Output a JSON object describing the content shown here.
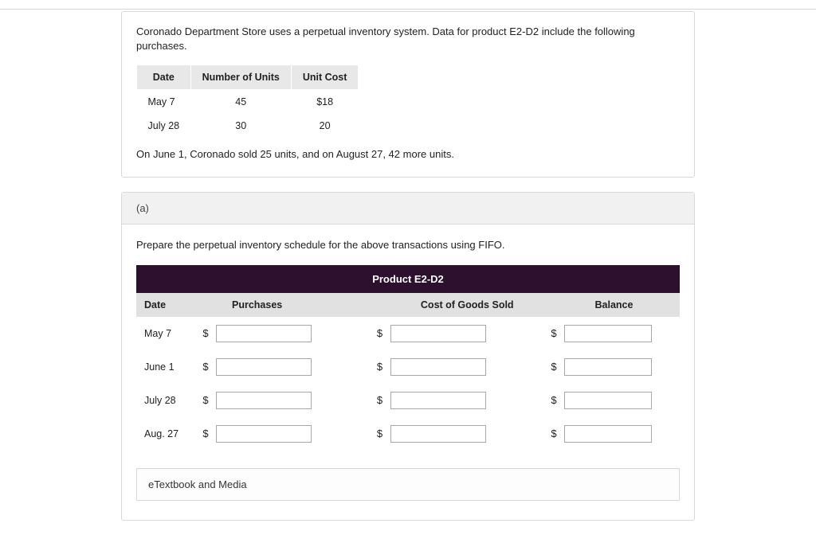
{
  "intro": "Coronado Department Store uses a perpetual inventory system. Data for product E2-D2 include the following purchases.",
  "purchase_table": {
    "headers": [
      "Date",
      "Number of Units",
      "Unit Cost"
    ],
    "rows": [
      {
        "date": "May 7",
        "units": "45",
        "cost": "$18"
      },
      {
        "date": "July 28",
        "units": "30",
        "cost": "20"
      }
    ]
  },
  "after_table": "On June 1, Coronado sold 25 units, and on August 27, 42 more units.",
  "part_label": "(a)",
  "instruction": "Prepare the perpetual inventory schedule for the above transactions using FIFO.",
  "schedule": {
    "title": "Product E2-D2",
    "columns": {
      "date": "Date",
      "purchases": "Purchases",
      "cogs": "Cost of Goods Sold",
      "balance": "Balance"
    },
    "rows": [
      {
        "date": "May 7"
      },
      {
        "date": "June 1"
      },
      {
        "date": "July 28"
      },
      {
        "date": "Aug. 27"
      }
    ]
  },
  "currency": "$",
  "etextbook": "eTextbook and Media"
}
